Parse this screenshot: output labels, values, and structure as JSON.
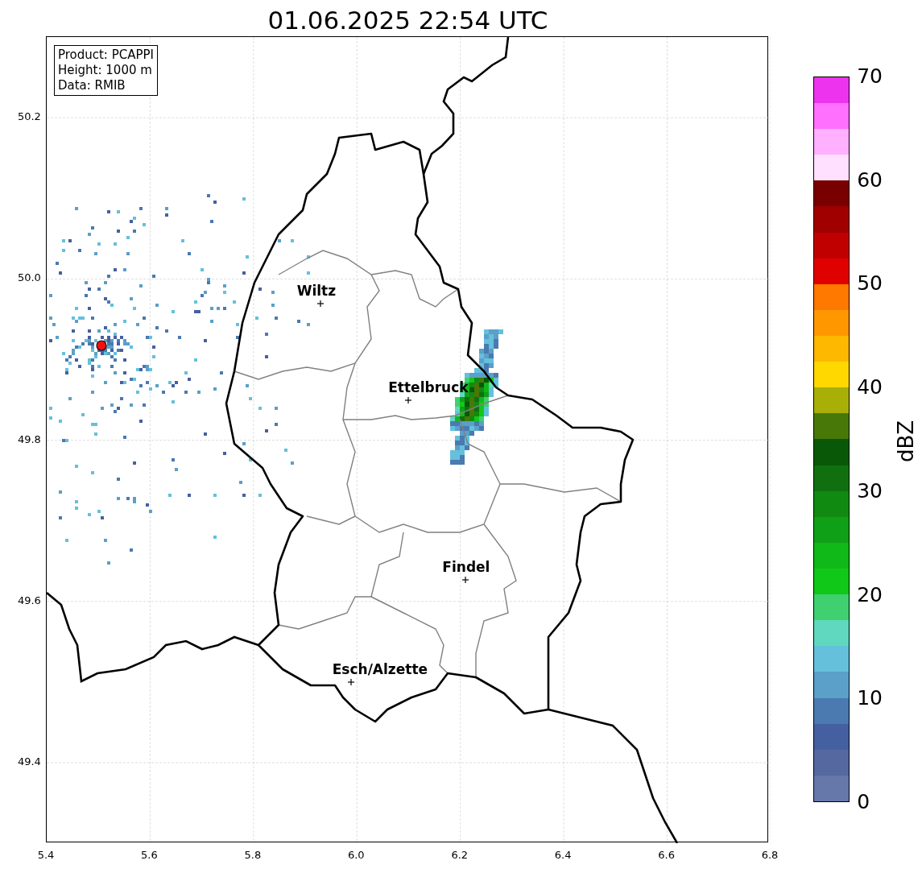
{
  "title": "01.06.2025 22:54 UTC",
  "info_box": [
    "Product: PCAPPI",
    "Height: 1000 m",
    "Data: RMIB"
  ],
  "x_ticks": [
    "5.4",
    "5.6",
    "5.8",
    "6.0",
    "6.2",
    "6.4",
    "6.6",
    "6.8"
  ],
  "y_ticks": [
    "50.2",
    "50.0",
    "49.8",
    "49.6",
    "49.4"
  ],
  "places": [
    {
      "name": "Wiltz"
    },
    {
      "name": "Ettelbruck"
    },
    {
      "name": "Findel"
    },
    {
      "name": "Esch/Alzette"
    }
  ],
  "colorbar": {
    "label": "dBZ",
    "ticks": [
      "70",
      "60",
      "50",
      "40",
      "30",
      "20",
      "10",
      "0"
    ],
    "bins": [
      {
        "color": "#6677aa"
      },
      {
        "color": "#5568a0"
      },
      {
        "color": "#4560a0"
      },
      {
        "color": "#4a7ab0"
      },
      {
        "color": "#5aa0c8"
      },
      {
        "color": "#65c0dc"
      },
      {
        "color": "#60d8c0"
      },
      {
        "color": "#40d070"
      },
      {
        "color": "#10c818"
      },
      {
        "color": "#10b818"
      },
      {
        "color": "#10a018"
      },
      {
        "color": "#108a10"
      },
      {
        "color": "#107010"
      },
      {
        "color": "#085808"
      },
      {
        "color": "#487808"
      },
      {
        "color": "#a8b008"
      },
      {
        "color": "#ffd800"
      },
      {
        "color": "#ffb800"
      },
      {
        "color": "#ff9800"
      },
      {
        "color": "#ff7800"
      },
      {
        "color": "#e00000"
      },
      {
        "color": "#c00000"
      },
      {
        "color": "#a00000"
      },
      {
        "color": "#780000"
      },
      {
        "color": "#ffe0ff"
      },
      {
        "color": "#ffb0ff"
      },
      {
        "color": "#ff70ff"
      },
      {
        "color": "#ee33ee"
      }
    ]
  }
}
